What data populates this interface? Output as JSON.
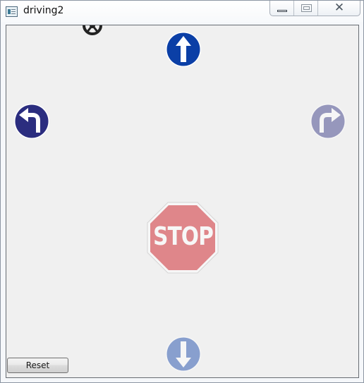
{
  "window": {
    "title": "driving2",
    "controls": {
      "minimize": "minimize",
      "maximize": "maximize",
      "close": "close"
    }
  },
  "canvas": {
    "steering_wheel": {
      "icon": "steering-wheel-icon"
    },
    "signs": {
      "up": {
        "icon": "arrow-up-icon",
        "color": "#0b3fa6"
      },
      "left": {
        "icon": "turn-left-icon",
        "color": "#2b2d7f"
      },
      "right": {
        "icon": "turn-right-icon",
        "color": "#a4a6cc"
      },
      "stop": {
        "icon": "stop-sign-icon",
        "text": "STOP",
        "color": "#e38e91"
      },
      "down": {
        "icon": "arrow-down-icon",
        "color": "#94aad9"
      }
    }
  },
  "footer": {
    "reset_label": "Reset"
  }
}
